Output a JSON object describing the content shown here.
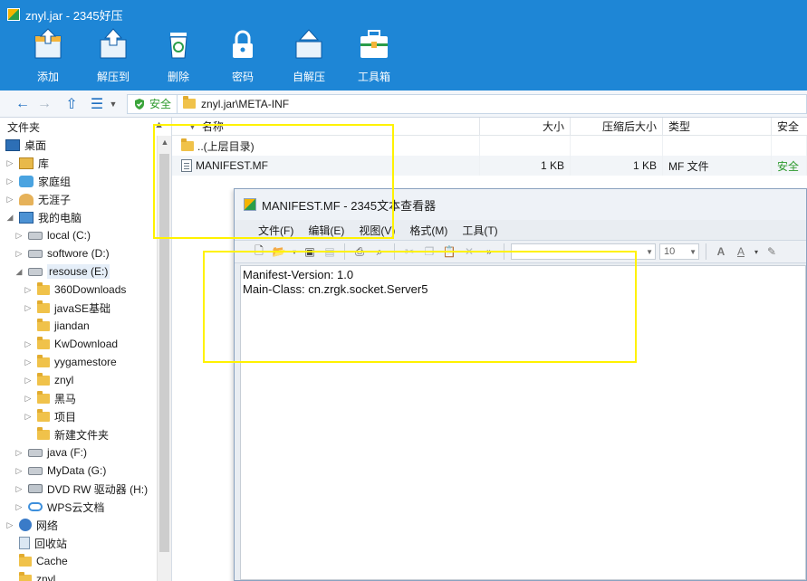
{
  "window": {
    "title": "znyl.jar - 2345好压"
  },
  "toolbar": {
    "items": [
      {
        "label": "添加",
        "icon": "add-archive-icon"
      },
      {
        "label": "解压到",
        "icon": "extract-icon"
      },
      {
        "label": "删除",
        "icon": "recycle-delete-icon"
      },
      {
        "label": "密码",
        "icon": "lock-icon"
      },
      {
        "label": "自解压",
        "icon": "self-extract-icon"
      },
      {
        "label": "工具箱",
        "icon": "toolbox-icon"
      }
    ]
  },
  "addressbar": {
    "safe_label": "安全",
    "path": "znyl.jar\\META-INF"
  },
  "tree": {
    "header": "文件夹",
    "items": [
      {
        "label": "桌面",
        "icon": "desktop-icon"
      },
      {
        "label": "库",
        "icon": "library-icon"
      },
      {
        "label": "家庭组",
        "icon": "homegroup-icon"
      },
      {
        "label": "无涯子",
        "icon": "user-folder-icon"
      },
      {
        "label": "我的电脑",
        "icon": "computer-icon"
      },
      {
        "label": "local (C:)",
        "icon": "drive-icon"
      },
      {
        "label": "softwore (D:)",
        "icon": "drive-icon"
      },
      {
        "label": "resouse (E:)",
        "icon": "drive-icon"
      },
      {
        "label": "360Downloads",
        "icon": "folder-icon"
      },
      {
        "label": "javaSE基础",
        "icon": "folder-icon"
      },
      {
        "label": "jiandan",
        "icon": "folder-icon"
      },
      {
        "label": "KwDownload",
        "icon": "folder-icon"
      },
      {
        "label": "yygamestore",
        "icon": "folder-icon"
      },
      {
        "label": "znyl",
        "icon": "folder-icon"
      },
      {
        "label": "黑马",
        "icon": "folder-icon"
      },
      {
        "label": "项目",
        "icon": "folder-icon"
      },
      {
        "label": "新建文件夹",
        "icon": "folder-icon"
      },
      {
        "label": "java (F:)",
        "icon": "drive-icon"
      },
      {
        "label": "MyData (G:)",
        "icon": "drive-icon"
      },
      {
        "label": "DVD RW 驱动器 (H:)",
        "icon": "dvd-drive-icon"
      },
      {
        "label": "WPS云文档",
        "icon": "cloud-icon"
      },
      {
        "label": "网络",
        "icon": "network-icon"
      },
      {
        "label": "回收站",
        "icon": "recycle-bin-icon"
      },
      {
        "label": "Cache",
        "icon": "folder-icon"
      },
      {
        "label": "znyl",
        "icon": "folder-icon"
      }
    ]
  },
  "filelist": {
    "columns": {
      "name": "名称",
      "size": "大小",
      "compressed": "压缩后大小",
      "type": "类型",
      "safety": "安全"
    },
    "rows": [
      {
        "name": "..(上层目录)",
        "size": "",
        "compressed": "",
        "type": "",
        "safety": ""
      },
      {
        "name": "MANIFEST.MF",
        "size": "1 KB",
        "compressed": "1 KB",
        "type": "MF 文件",
        "safety": "安全"
      }
    ]
  },
  "viewer": {
    "title": "MANIFEST.MF - 2345文本查看器",
    "menu": [
      "文件(F)",
      "编辑(E)",
      "视图(V)",
      "格式(M)",
      "工具(T)"
    ],
    "font_size": "10",
    "lines": [
      "Manifest-Version: 1.0",
      "Main-Class: cn.zrgk.socket.Server5"
    ]
  },
  "colors": {
    "titlebar": "#1e86d6",
    "highlight": "#fff200",
    "safe_green": "#2e9a2e"
  }
}
